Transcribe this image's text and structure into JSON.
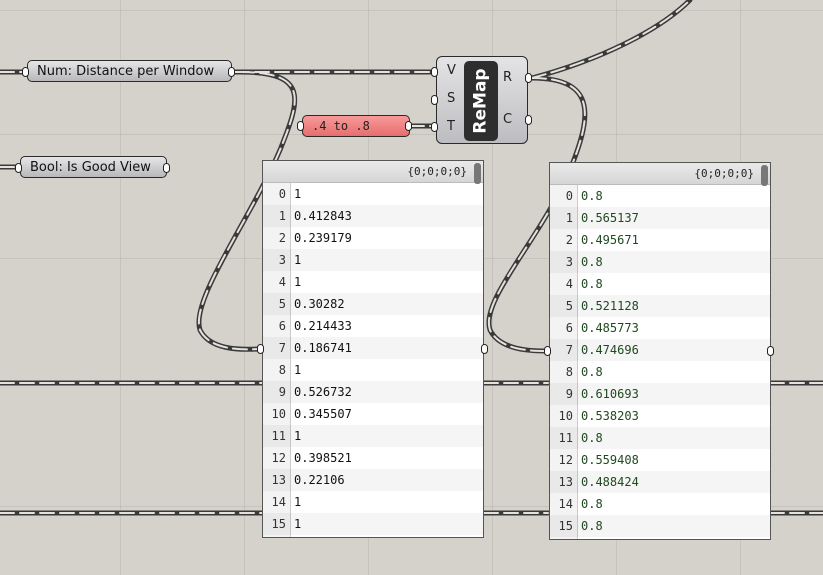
{
  "canvas": {
    "distance_param": "Num: Distance per Window",
    "view_param": "Bool: Is Good View",
    "slider_label": ".4 to .8"
  },
  "remap": {
    "label": "ReMap",
    "inputs": [
      "V",
      "S",
      "T"
    ],
    "outputs": [
      "R",
      "C"
    ]
  },
  "input_panel": {
    "path": "{0;0;0;0}",
    "rows": [
      {
        "i": "0",
        "v": "1"
      },
      {
        "i": "1",
        "v": "0.412843"
      },
      {
        "i": "2",
        "v": "0.239179"
      },
      {
        "i": "3",
        "v": "1"
      },
      {
        "i": "4",
        "v": "1"
      },
      {
        "i": "5",
        "v": "0.30282"
      },
      {
        "i": "6",
        "v": "0.214433"
      },
      {
        "i": "7",
        "v": "0.186741"
      },
      {
        "i": "8",
        "v": "1"
      },
      {
        "i": "9",
        "v": "0.526732"
      },
      {
        "i": "10",
        "v": "0.345507"
      },
      {
        "i": "11",
        "v": "1"
      },
      {
        "i": "12",
        "v": "0.398521"
      },
      {
        "i": "13",
        "v": "0.22106"
      },
      {
        "i": "14",
        "v": "1"
      },
      {
        "i": "15",
        "v": "1"
      }
    ]
  },
  "output_panel": {
    "path": "{0;0;0;0}",
    "rows": [
      {
        "i": "0",
        "v": "0.8"
      },
      {
        "i": "1",
        "v": "0.565137"
      },
      {
        "i": "2",
        "v": "0.495671"
      },
      {
        "i": "3",
        "v": "0.8"
      },
      {
        "i": "4",
        "v": "0.8"
      },
      {
        "i": "5",
        "v": "0.521128"
      },
      {
        "i": "6",
        "v": "0.485773"
      },
      {
        "i": "7",
        "v": "0.474696"
      },
      {
        "i": "8",
        "v": "0.8"
      },
      {
        "i": "9",
        "v": "0.610693"
      },
      {
        "i": "10",
        "v": "0.538203"
      },
      {
        "i": "11",
        "v": "0.8"
      },
      {
        "i": "12",
        "v": "0.559408"
      },
      {
        "i": "13",
        "v": "0.488424"
      },
      {
        "i": "14",
        "v": "0.8"
      },
      {
        "i": "15",
        "v": "0.8"
      }
    ]
  }
}
